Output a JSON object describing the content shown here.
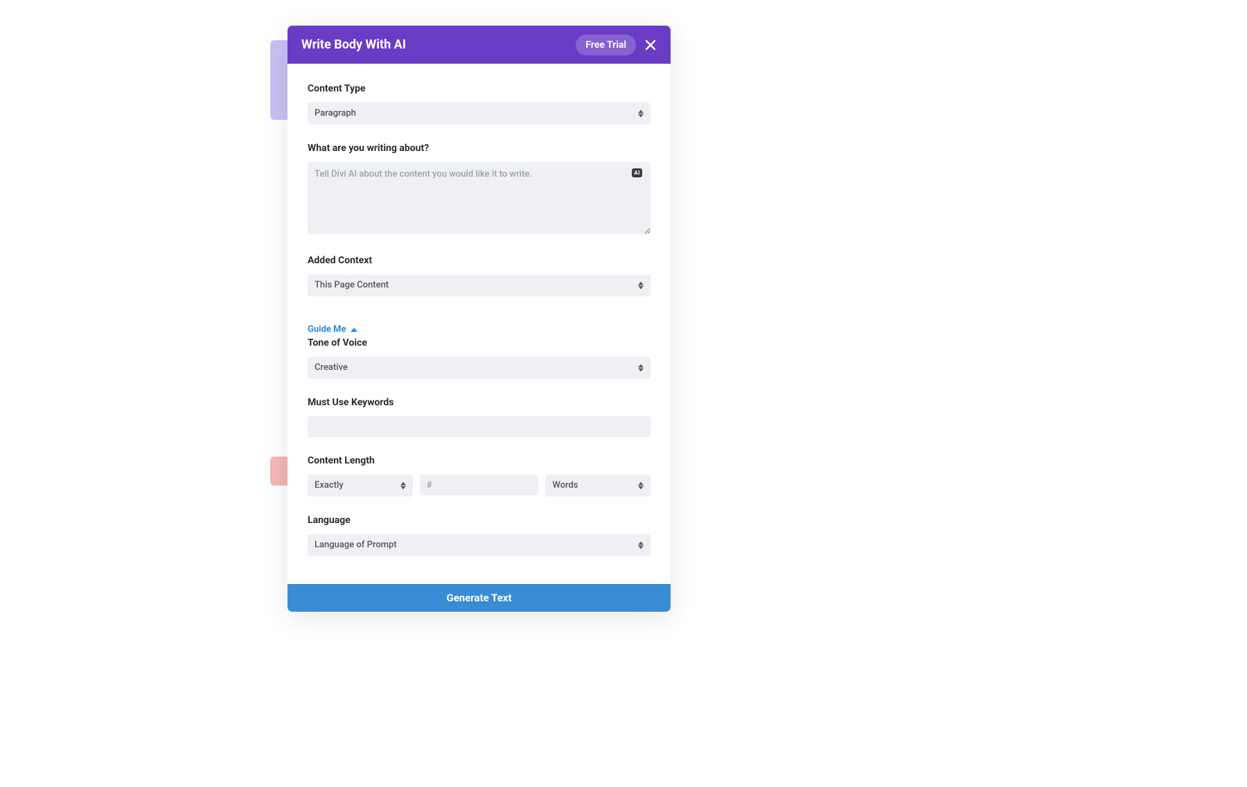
{
  "header": {
    "title": "Write Body With AI",
    "free_trial_label": "Free Trial"
  },
  "content_type": {
    "label": "Content Type",
    "value": "Paragraph"
  },
  "writing_about": {
    "label": "What are you writing about?",
    "placeholder": "Tell Divi AI about the content you would like it to write.",
    "ai_badge": "AI"
  },
  "added_context": {
    "label": "Added Context",
    "value": "This Page Content"
  },
  "guide_me": {
    "label": "Guide Me"
  },
  "tone": {
    "label": "Tone of Voice",
    "value": "Creative"
  },
  "keywords": {
    "label": "Must Use Keywords"
  },
  "content_length": {
    "label": "Content Length",
    "mode": "Exactly",
    "count_placeholder": "#",
    "unit": "Words"
  },
  "language": {
    "label": "Language",
    "value": "Language of Prompt"
  },
  "generate": {
    "label": "Generate Text"
  }
}
